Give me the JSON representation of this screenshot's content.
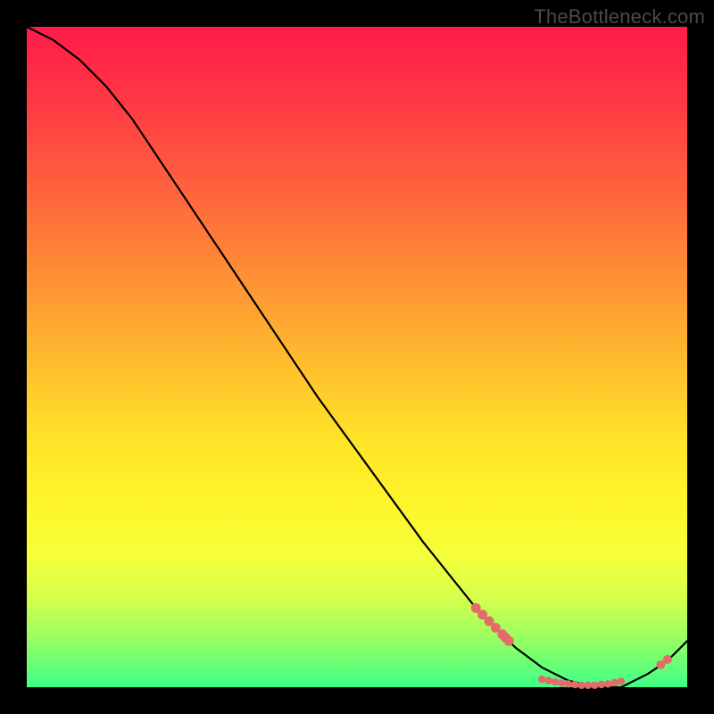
{
  "watermark": "TheBottleneck.com",
  "colors": {
    "background": "#000000",
    "gradient_top": "#ff1a4a",
    "gradient_mid1": "#ff8a36",
    "gradient_mid2": "#ffe228",
    "gradient_bottom": "#3fff88",
    "line": "#000000",
    "marker": "#e46b6b"
  },
  "chart_data": {
    "type": "line",
    "title": "",
    "xlabel": "",
    "ylabel": "",
    "xlim": [
      0,
      100
    ],
    "ylim": [
      0,
      100
    ],
    "grid": false,
    "series": [
      {
        "name": "curve",
        "x": [
          0,
          4,
          8,
          12,
          16,
          20,
          28,
          36,
          44,
          52,
          60,
          68,
          74,
          78,
          82,
          86,
          90,
          94,
          97,
          100
        ],
        "y": [
          100,
          98,
          95,
          91,
          86,
          80,
          68,
          56,
          44,
          33,
          22,
          12,
          6,
          3,
          1,
          0,
          0,
          2,
          4,
          7
        ]
      }
    ],
    "markers": {
      "cluster_descending": [
        {
          "x": 68,
          "y": 12
        },
        {
          "x": 69,
          "y": 11
        },
        {
          "x": 70,
          "y": 10
        },
        {
          "x": 71,
          "y": 9
        },
        {
          "x": 72,
          "y": 8
        },
        {
          "x": 72.5,
          "y": 7.5
        },
        {
          "x": 73,
          "y": 7
        }
      ],
      "bottom_row": [
        {
          "x": 78,
          "y": 1.2
        },
        {
          "x": 79,
          "y": 1.0
        },
        {
          "x": 80,
          "y": 0.8
        },
        {
          "x": 81,
          "y": 0.6
        },
        {
          "x": 82,
          "y": 0.5
        },
        {
          "x": 83,
          "y": 0.4
        },
        {
          "x": 84,
          "y": 0.3
        },
        {
          "x": 85,
          "y": 0.3
        },
        {
          "x": 86,
          "y": 0.3
        },
        {
          "x": 87,
          "y": 0.4
        },
        {
          "x": 88,
          "y": 0.5
        },
        {
          "x": 89,
          "y": 0.7
        },
        {
          "x": 90,
          "y": 0.9
        }
      ],
      "right_pair": [
        {
          "x": 96,
          "y": 3.4
        },
        {
          "x": 97,
          "y": 4.2
        }
      ]
    }
  }
}
